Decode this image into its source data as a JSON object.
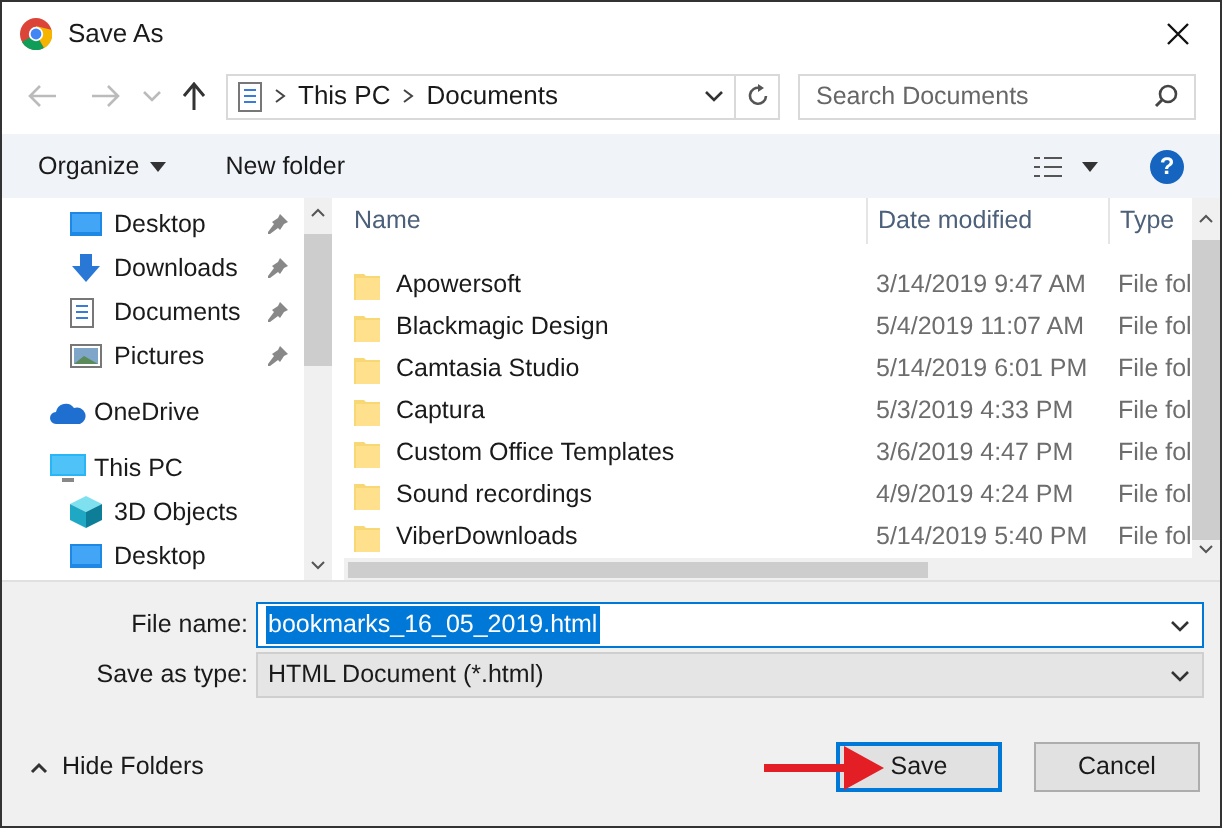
{
  "window": {
    "title": "Save As"
  },
  "address": {
    "path": [
      "This PC",
      "Documents"
    ]
  },
  "search": {
    "placeholder": "Search Documents"
  },
  "toolbar": {
    "organize": "Organize",
    "new_folder": "New folder",
    "help": "?"
  },
  "nav": [
    {
      "label": "Desktop",
      "kind": "desktop",
      "pinned": true
    },
    {
      "label": "Downloads",
      "kind": "downloads",
      "pinned": true
    },
    {
      "label": "Documents",
      "kind": "documents",
      "pinned": true
    },
    {
      "label": "Pictures",
      "kind": "pictures",
      "pinned": true
    },
    {
      "label": "OneDrive",
      "kind": "cloud",
      "pinned": false
    },
    {
      "label": "This PC",
      "kind": "pc",
      "pinned": false,
      "children": [
        {
          "label": "3D Objects",
          "kind": "objects",
          "pinned": false
        },
        {
          "label": "Desktop",
          "kind": "desktop",
          "pinned": false
        }
      ]
    }
  ],
  "table": {
    "columns": [
      "Name",
      "Date modified",
      "Type"
    ],
    "rows": [
      {
        "name": "Apowersoft",
        "date": "3/14/2019 9:47 AM",
        "type": "File fol"
      },
      {
        "name": "Blackmagic Design",
        "date": "5/4/2019 11:07 AM",
        "type": "File fol"
      },
      {
        "name": "Camtasia Studio",
        "date": "5/14/2019 6:01 PM",
        "type": "File fol"
      },
      {
        "name": "Captura",
        "date": "5/3/2019 4:33 PM",
        "type": "File fol"
      },
      {
        "name": "Custom Office Templates",
        "date": "3/6/2019 4:47 PM",
        "type": "File fol"
      },
      {
        "name": "Sound recordings",
        "date": "4/9/2019 4:24 PM",
        "type": "File fol"
      },
      {
        "name": "ViberDownloads",
        "date": "5/14/2019 5:40 PM",
        "type": "File fol"
      }
    ]
  },
  "file_name": {
    "label": "File name:",
    "value": "bookmarks_16_05_2019.html"
  },
  "save_as_type": {
    "label": "Save as type:",
    "value": "HTML Document (*.html)"
  },
  "hide_folders": "Hide Folders",
  "buttons": [
    {
      "label": "Save",
      "kind": "primary"
    },
    {
      "label": "Cancel",
      "kind": "normal"
    }
  ]
}
